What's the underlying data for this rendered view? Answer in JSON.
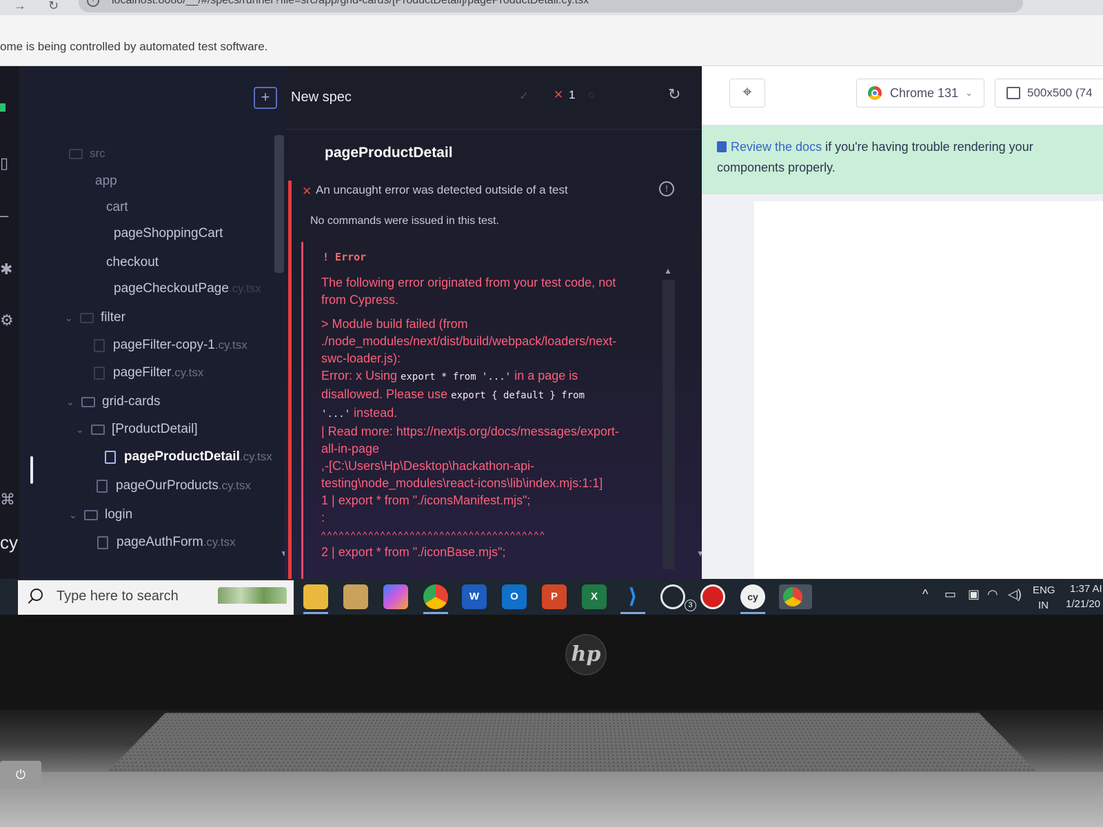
{
  "browser": {
    "url": "localhost:8080/__/#/specs/runner?file=src/app/grid-cards/[ProductDetail]/pageProductDetail.cy.tsx",
    "automation_notice": "ome is being controlled by automated test software."
  },
  "spec_list": {
    "new_spec_label": "New spec",
    "items": [
      {
        "type": "folder",
        "label": "src",
        "ext": ""
      },
      {
        "type": "folder",
        "label": "app",
        "ext": ""
      },
      {
        "type": "folder",
        "label": "cart",
        "ext": ""
      },
      {
        "type": "file",
        "label": "pageShoppingCart",
        "ext": ""
      },
      {
        "type": "folder",
        "label": "checkout",
        "ext": ""
      },
      {
        "type": "file",
        "label": "pageCheckoutPage",
        "ext": ".cy.tsx"
      },
      {
        "type": "folder",
        "label": "filter",
        "ext": ""
      },
      {
        "type": "file",
        "label": "pageFilter-copy-1",
        "ext": ".cy.tsx"
      },
      {
        "type": "file",
        "label": "pageFilter",
        "ext": ".cy.tsx"
      },
      {
        "type": "folder",
        "label": "grid-cards",
        "ext": ""
      },
      {
        "type": "folder",
        "label": "[ProductDetail]",
        "ext": ""
      },
      {
        "type": "file",
        "label": "pageProductDetail",
        "ext": ".cy.tsx",
        "active": true
      },
      {
        "type": "file",
        "label": "pageOurProducts",
        "ext": ".cy.tsx"
      },
      {
        "type": "folder",
        "label": "login",
        "ext": ""
      },
      {
        "type": "file",
        "label": "pageAuthForm",
        "ext": ".cy.tsx"
      }
    ]
  },
  "reporter": {
    "stats": {
      "passed_icon": "✓",
      "failed_icon": "✕",
      "failed": "1",
      "pending_icon": "○"
    },
    "spec_title": "pageProductDetail",
    "uncaught_error": "An uncaught error was detected outside of a test",
    "no_commands": "No commands were issued in this test.",
    "error_heading": "!   Error",
    "error_lines": [
      "The following error originated from your test code, not",
      "from Cypress.",
      "> Module build failed (from",
      "./node_modules/next/dist/build/webpack/loaders/next-",
      "swc-loader.js):",
      "Error:  x Using",
      "export * from '...'",
      " in a page is",
      "disallowed. Please use",
      "export { default } from",
      "'...'",
      " instead.",
      "| Read more: https://nextjs.org/docs/messages/export-",
      "all-in-page",
      ",-[C:\\Users\\Hp\\Desktop\\hackathon-api-",
      "testing\\node_modules\\react-icons\\lib\\index.mjs:1:1]",
      "1 | export * from \"./iconsManifest.mjs\";",
      ":",
      "^^^^^^^^^^^^^^^^^^^^^^^^^^^^^^^^^^^^^^",
      "2 | export * from \"./iconBase.mjs\";"
    ]
  },
  "preview": {
    "browser_label": "Chrome 131",
    "viewport_label": "500x500 (74",
    "docs_link": "Review the docs",
    "docs_text": " if you're having trouble rendering your",
    "docs_text2": "components properly."
  },
  "taskbar": {
    "search_placeholder": "Type here to search",
    "apps": [
      {
        "name": "file-explorer",
        "label": ""
      },
      {
        "name": "notes",
        "label": ""
      },
      {
        "name": "copilot",
        "label": ""
      },
      {
        "name": "chrome",
        "label": ""
      },
      {
        "name": "word",
        "label": "W"
      },
      {
        "name": "outlook",
        "label": "O"
      },
      {
        "name": "powerpoint",
        "label": "P"
      },
      {
        "name": "excel",
        "label": "X"
      },
      {
        "name": "vscode",
        "label": ""
      },
      {
        "name": "whatsapp",
        "label": ""
      },
      {
        "name": "recorder",
        "label": ""
      },
      {
        "name": "cypress",
        "label": "cy"
      },
      {
        "name": "chrome-2",
        "label": ""
      }
    ],
    "whatsapp_badge": "3",
    "language_top": "ENG",
    "language_bottom": "IN",
    "time": "1:37 AI",
    "date": "1/21/20"
  },
  "laptop": {
    "brand": "hp"
  },
  "colors": {
    "fail_red": "#e63c3c",
    "error_text": "#ff5f7a",
    "banner_green": "#c9efd8",
    "link_blue": "#3563c9"
  }
}
